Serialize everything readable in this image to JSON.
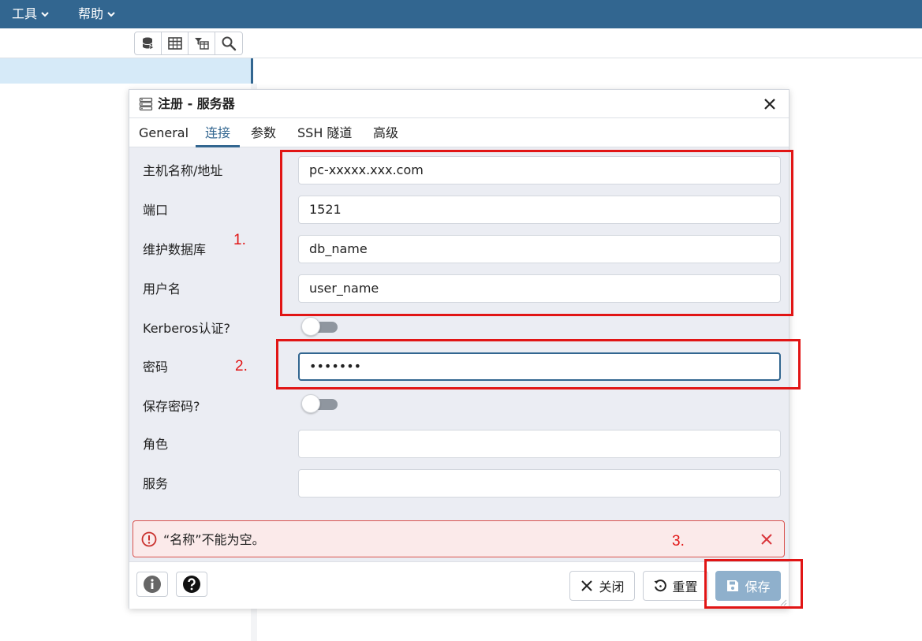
{
  "topbar": {
    "menus": [
      {
        "label": "工具"
      },
      {
        "label": "帮助"
      }
    ]
  },
  "toolbar": {
    "buttons": [
      "database-query-icon",
      "table-icon",
      "filtered-rows-icon",
      "search-icon"
    ]
  },
  "dialog": {
    "title": "注册 - 服务器",
    "tabs": [
      "General",
      "连接",
      "参数",
      "SSH 隧道",
      "高级"
    ],
    "active_tab": "连接",
    "fields": {
      "host": {
        "label": "主机名称/地址",
        "value": "pc-xxxxx.xxx.com"
      },
      "port": {
        "label": "端口",
        "value": "1521"
      },
      "maintenance_db": {
        "label": "维护数据库",
        "value": "db_name"
      },
      "username": {
        "label": "用户名",
        "value": "user_name"
      },
      "kerberos": {
        "label": "Kerberos认证?",
        "value": "off"
      },
      "password": {
        "label": "密码",
        "value": "•••••••"
      },
      "save_password": {
        "label": "保存密码?",
        "value": "off"
      },
      "role": {
        "label": "角色",
        "value": ""
      },
      "service": {
        "label": "服务",
        "value": ""
      }
    },
    "error": "“名称”不能为空。",
    "footer": {
      "close_label": "关闭",
      "reset_label": "重置",
      "save_label": "保存"
    }
  },
  "annotations": {
    "step1": "1.",
    "step2": "2.",
    "step3": "3."
  },
  "colors": {
    "brand": "#326690",
    "annotation": "#e11515",
    "error_bg": "#fbeaea",
    "primary_disabled": "#8fb0cc"
  }
}
